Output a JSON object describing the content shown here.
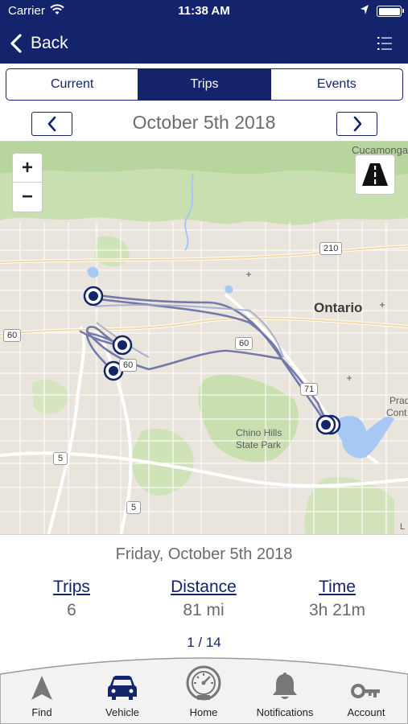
{
  "status_bar": {
    "carrier": "Carrier",
    "time": "11:38 AM"
  },
  "nav": {
    "back_label": "Back"
  },
  "segments": [
    {
      "label": "Current",
      "active": false
    },
    {
      "label": "Trips",
      "active": true
    },
    {
      "label": "Events",
      "active": false
    }
  ],
  "date_nav": {
    "title": "October 5th 2018"
  },
  "map": {
    "zoom_in": "+",
    "zoom_out": "−",
    "labels": {
      "ontario": "Ontario",
      "cucamonga": "Cucamonga",
      "chino_hills_1": "Chino Hills",
      "chino_hills_2": "State Park",
      "prado_1": "Prad",
      "prado_2": "Cont",
      "legal": "L"
    },
    "shields": {
      "r210": "210",
      "r60_west": "60",
      "r60_mid": "60",
      "r60_east": "60",
      "r71": "71",
      "r5_north": "5",
      "r5_south": "5"
    },
    "route_color": "#6f74a8",
    "marker_color": "#13246d"
  },
  "summary": {
    "date": "Friday, October 5th 2018",
    "trips_label": "Trips",
    "trips_value": "6",
    "distance_label": "Distance",
    "distance_value": "81 mi",
    "time_label": "Time",
    "time_value": "3h 21m",
    "pager": "1 / 14"
  },
  "tabs": [
    {
      "label": "Find",
      "icon": "navigation-arrow-icon"
    },
    {
      "label": "Vehicle",
      "icon": "car-icon"
    },
    {
      "label": "Home",
      "icon": "speedometer-icon"
    },
    {
      "label": "Notifications",
      "icon": "bell-icon"
    },
    {
      "label": "Account",
      "icon": "key-icon"
    }
  ],
  "colors": {
    "brand": "#13246d",
    "text_gray": "#6b6b6b",
    "water": "#a7c8f2",
    "park": "#c9dfb0"
  }
}
